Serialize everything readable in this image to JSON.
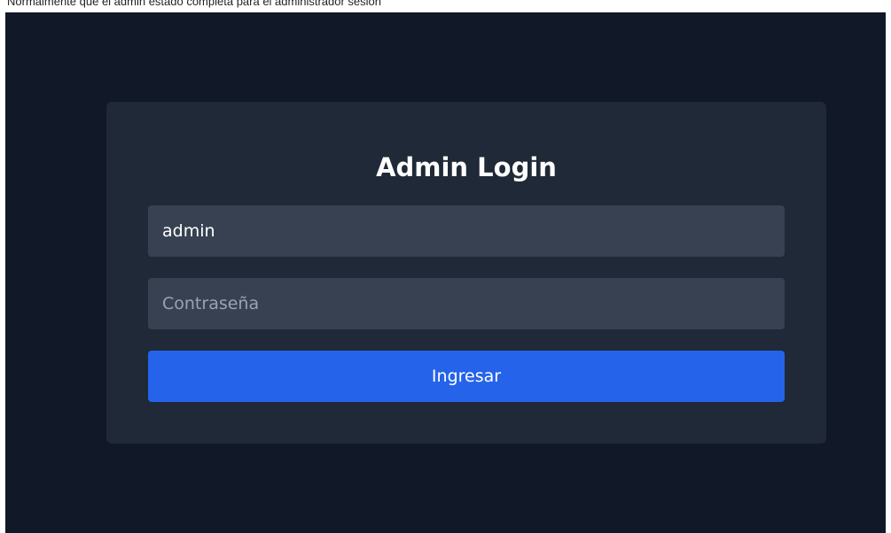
{
  "caption": "Normalmente que el admin estado completa para el administrador sesión",
  "login": {
    "title": "Admin Login",
    "username": {
      "value": "admin",
      "placeholder": ""
    },
    "password": {
      "value": "",
      "placeholder": "Contraseña"
    },
    "submit_label": "Ingresar"
  },
  "colors": {
    "background": "#111827",
    "card": "#1f2937",
    "input": "#374151",
    "button": "#2563eb",
    "text": "#ffffff",
    "placeholder": "#9ca3af"
  }
}
